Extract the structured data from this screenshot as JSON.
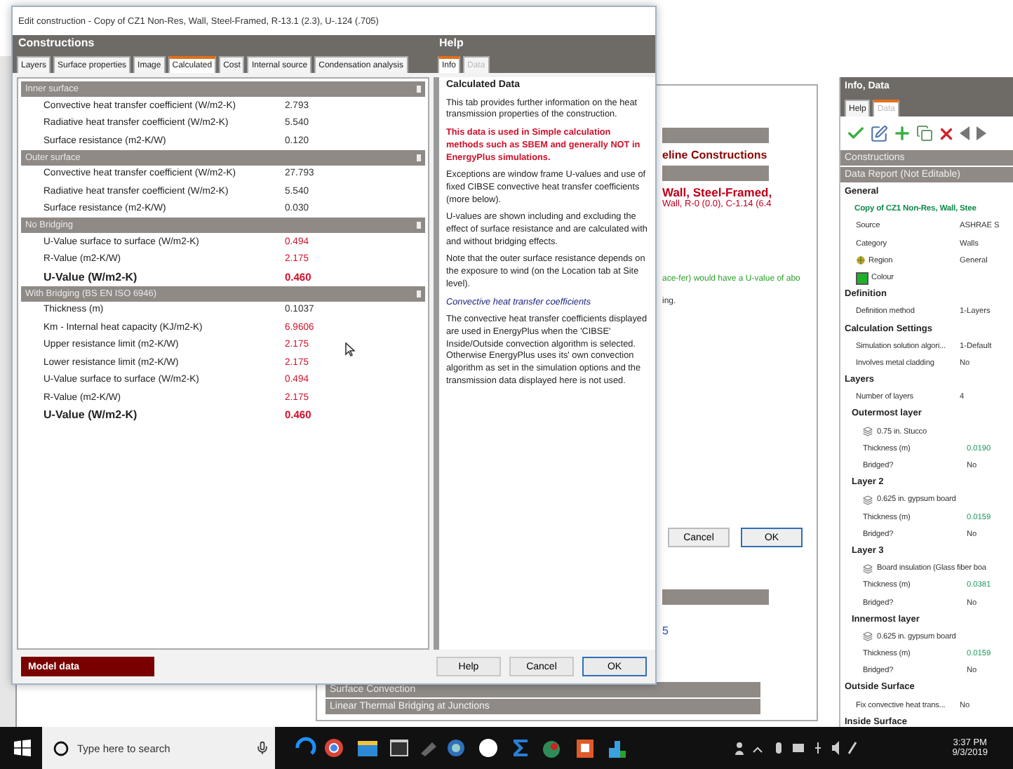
{
  "dialog": {
    "title": "Edit construction - Copy of CZ1 Non-Res, Wall, Steel-Framed, R-13.1 (2.3), U-.124 (.705)",
    "panel_title": "Constructions",
    "tabs": [
      {
        "label": "Layers",
        "selected": false
      },
      {
        "label": "Surface properties",
        "selected": false
      },
      {
        "label": "Image",
        "selected": false
      },
      {
        "label": "Calculated",
        "selected": true
      },
      {
        "label": "Cost",
        "selected": false
      },
      {
        "label": "Internal source",
        "selected": false
      },
      {
        "label": "Condensation analysis",
        "selected": false
      }
    ],
    "groups": [
      {
        "title": "Inner surface",
        "rows": [
          {
            "label": "Convective heat transfer coefficient (W/m2-K)",
            "value": "2.793",
            "kind": "plain",
            "highlighted": false
          },
          {
            "label": "Radiative heat transfer coefficient (W/m2-K)",
            "value": "5.540",
            "kind": "plain",
            "highlighted": false
          },
          {
            "label": "Surface resistance (m2-K/W)",
            "value": "0.120",
            "kind": "plain",
            "highlighted": false
          }
        ]
      },
      {
        "title": "Outer surface",
        "rows": [
          {
            "label": "Convective heat transfer coefficient (W/m2-K)",
            "value": "27.793",
            "kind": "plain",
            "highlighted": false
          },
          {
            "label": "Radiative heat transfer coefficient (W/m2-K)",
            "value": "5.540",
            "kind": "plain",
            "highlighted": false
          },
          {
            "label": "Surface resistance (m2-K/W)",
            "value": "0.030",
            "kind": "plain",
            "highlighted": false
          }
        ]
      },
      {
        "title": "No Bridging",
        "rows": [
          {
            "label": "U-Value surface to surface (W/m2-K)",
            "value": "0.494",
            "kind": "plain",
            "highlighted": true
          },
          {
            "label": "R-Value (m2-K/W)",
            "value": "2.175",
            "kind": "plain",
            "highlighted": true
          },
          {
            "label": "U-Value (W/m2-K)",
            "value": "0.460",
            "kind": "total",
            "highlighted": true
          }
        ]
      },
      {
        "title": "With Bridging (BS EN ISO 6946)",
        "rows": [
          {
            "label": "Thickness (m)",
            "value": "0.1037",
            "kind": "plain",
            "highlighted": false
          },
          {
            "label": "Km - Internal heat capacity (KJ/m2-K)",
            "value": "6.9606",
            "kind": "plain",
            "highlighted": true
          },
          {
            "label": "Upper resistance limit (m2-K/W)",
            "value": "2.175",
            "kind": "plain",
            "highlighted": true
          },
          {
            "label": "Lower resistance limit (m2-K/W)",
            "value": "2.175",
            "kind": "plain",
            "highlighted": true
          },
          {
            "label": "U-Value surface to surface (W/m2-K)",
            "value": "0.494",
            "kind": "plain",
            "highlighted": true
          },
          {
            "label": "R-Value (m2-K/W)",
            "value": "2.175",
            "kind": "plain",
            "highlighted": true
          },
          {
            "label": "U-Value (W/m2-K)",
            "value": "0.460",
            "kind": "total",
            "highlighted": true
          }
        ]
      }
    ],
    "help": {
      "title": "Help",
      "tabs": [
        {
          "label": "Info",
          "selected": true
        },
        {
          "label": "Data",
          "selected": false
        }
      ],
      "paragraphs": [
        {
          "kind": "heading",
          "text": "Calculated Data"
        },
        {
          "kind": "text",
          "text": "This tab provides further information on the heat transmission properties of the construction."
        },
        {
          "kind": "warning",
          "text": "This data is used in Simple calculation methods such as SBEM and generally NOT in EnergyPlus simulations."
        },
        {
          "kind": "text",
          "text": "Exceptions are window frame U-values and use of fixed CIBSE convective heat transfer coefficients (more below)."
        },
        {
          "kind": "text",
          "text": "U-values are shown including and excluding the effect of surface resistance and are calculated with and without bridging effects."
        },
        {
          "kind": "text",
          "text": "Note that the outer surface resistance depends on the exposure to wind (on the Location tab at Site level)."
        },
        {
          "kind": "subheading",
          "text": "Convective heat transfer coefficients"
        },
        {
          "kind": "text",
          "text": "The convective heat transfer coefficients displayed are used in EnergyPlus when the 'CIBSE' Inside/Outside convection algorithm is selected.  Otherwise EnergyPlus uses its' own convection algorithm as set in the simulation options and the transmission data displayed here is not used."
        }
      ]
    },
    "model_data": "Model data",
    "buttons": [
      "Help",
      "Cancel",
      "OK"
    ]
  },
  "background_window": {
    "list_title": "eline Constructions",
    "item_title": "Wall, Steel-Framed,",
    "item_detail": "Wall, R-0 (0.0), C-1.14 (6.4",
    "note": "ace-fer) would have a U-value of abo",
    "note_end": "ing.",
    "buttons": [
      "Cancel",
      "OK"
    ],
    "count": "5",
    "bars": [
      "Surface Convection",
      "Linear Thermal Bridging at Junctions"
    ]
  },
  "info_panel": {
    "title": "Info, Data",
    "tabs": [
      {
        "label": "Help",
        "selected": false
      },
      {
        "label": "Data",
        "selected": true
      }
    ],
    "bars": [
      "Constructions",
      "Data Report (Not Editable)"
    ],
    "tree": [
      {
        "kind": "group",
        "label": "General",
        "children": [
          {
            "kind": "title",
            "label": "Copy of CZ1 Non-Res, Wall, Stee"
          },
          {
            "kind": "field",
            "label": "Source",
            "value": "ASHRAE S"
          },
          {
            "kind": "field",
            "label": "Category",
            "value": "Walls"
          },
          {
            "kind": "icon-field",
            "label": "Region",
            "value": "General"
          },
          {
            "kind": "swatch",
            "label": "Colour",
            "color": "#1fb02a"
          }
        ]
      },
      {
        "kind": "group",
        "label": "Definition",
        "children": [
          {
            "kind": "field",
            "label": "Definition method",
            "value": "1-Layers"
          }
        ]
      },
      {
        "kind": "group",
        "label": "Calculation Settings",
        "children": [
          {
            "kind": "field",
            "label": "Simulation solution algori...",
            "value": "1-Default"
          },
          {
            "kind": "field",
            "label": "Involves metal cladding",
            "value": "No"
          }
        ]
      },
      {
        "kind": "group",
        "label": "Layers",
        "children": [
          {
            "kind": "field",
            "label": "Number of layers",
            "value": "4"
          },
          {
            "kind": "group",
            "label": "Outermost layer",
            "children": [
              {
                "kind": "material",
                "label": "0.75 in. Stucco"
              },
              {
                "kind": "measure",
                "label": "Thickness (m)",
                "value": "0.0190"
              },
              {
                "kind": "field",
                "label": "Bridged?",
                "value": "No"
              }
            ]
          },
          {
            "kind": "group",
            "label": "Layer 2",
            "children": [
              {
                "kind": "material",
                "label": "0.625 in. gypsum board"
              },
              {
                "kind": "measure",
                "label": "Thickness (m)",
                "value": "0.0159"
              },
              {
                "kind": "field",
                "label": "Bridged?",
                "value": "No"
              }
            ]
          },
          {
            "kind": "group",
            "label": "Layer 3",
            "children": [
              {
                "kind": "material",
                "label": "Board insulation (Glass fiber boa"
              },
              {
                "kind": "measure",
                "label": "Thickness (m)",
                "value": "0.0381"
              },
              {
                "kind": "field",
                "label": "Bridged?",
                "value": "No"
              }
            ]
          },
          {
            "kind": "group",
            "label": "Innermost layer",
            "children": [
              {
                "kind": "material",
                "label": "0.625 in. gypsum board"
              },
              {
                "kind": "measure",
                "label": "Thickness (m)",
                "value": "0.0159"
              },
              {
                "kind": "field",
                "label": "Bridged?",
                "value": "No"
              }
            ]
          }
        ]
      },
      {
        "kind": "group",
        "label": "Outside Surface",
        "children": [
          {
            "kind": "field",
            "label": "Fix convective heat trans...",
            "value": "No"
          }
        ]
      },
      {
        "kind": "group",
        "label": "Inside Surface"
      }
    ]
  },
  "taskbar": {
    "search_placeholder": "Type here to search",
    "time": "3:37 PM",
    "date": "9/3/2019"
  }
}
